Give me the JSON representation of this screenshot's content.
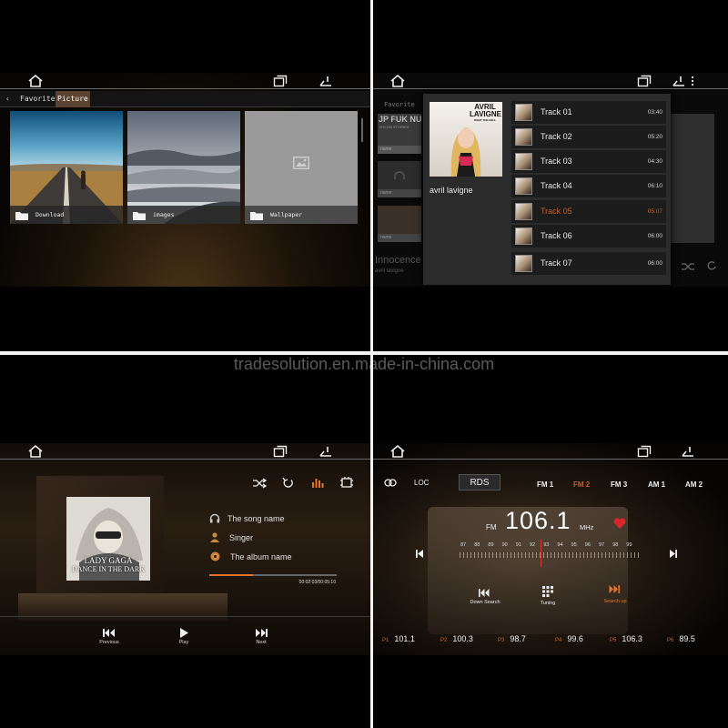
{
  "watermark": "tradesolution.en.made-in-china.com",
  "colors": {
    "accent": "#c0602a",
    "divider": "#f2f2f2",
    "tile_empty": "#9a9a9a",
    "heart": "#d8262b"
  },
  "gallery": {
    "breadcrumb": {
      "back_icon": "chevron-left-icon",
      "favorite": "Favorite",
      "picture": "Picture"
    },
    "folders": [
      {
        "label": "Download",
        "icon": "folder-icon"
      },
      {
        "label": "images",
        "icon": "folder-icon"
      },
      {
        "label": "Wallpaper",
        "icon": "folder-icon"
      }
    ]
  },
  "music": {
    "bg_tab": "Favorite",
    "bg_tiles": [
      "name",
      "name",
      "name"
    ],
    "bg_song": "Innocence",
    "bg_artist": "avril lavigne",
    "album_cover_text": [
      "AVRIL",
      "LAVIGNE",
      "WHAT THE HELL"
    ],
    "bg_album_text": [
      "JP FUK NUT",
      "NYLON STORIES"
    ],
    "artist": "avril lavigne",
    "tracks": [
      {
        "name": "Track 01",
        "duration": "03:40",
        "active": false
      },
      {
        "name": "Track 02",
        "duration": "05:20",
        "active": false
      },
      {
        "name": "Track 03",
        "duration": "04:30",
        "active": false
      },
      {
        "name": "Track 04",
        "duration": "06:10",
        "active": false
      },
      {
        "name": "Track 05",
        "duration": "05:07",
        "active": true
      },
      {
        "name": "Track 06",
        "duration": "06:00",
        "active": false
      },
      {
        "name": "Track 07",
        "duration": "06:00",
        "active": false
      }
    ]
  },
  "player": {
    "album_text_line1": "LADY GAGA",
    "album_text_line2": "DANCE IN THE DARK",
    "song_name": "The song name",
    "singer": "Singer",
    "album_name": "The album name",
    "time": "00:02:03/00:05:10",
    "progress": 0.34,
    "controls": {
      "previous": "Previous",
      "play": "Play",
      "next": "Next"
    }
  },
  "radio": {
    "loc": "LOC",
    "rds": "RDS",
    "bands": [
      {
        "label": "FM 1",
        "active": false
      },
      {
        "label": "FM 2",
        "active": true
      },
      {
        "label": "FM 3",
        "active": false
      },
      {
        "label": "AM 1",
        "active": false
      },
      {
        "label": "AM 2",
        "active": false
      }
    ],
    "band_label": "FM",
    "frequency": "106.1",
    "unit": "MHz",
    "scale": [
      "87",
      "88",
      "89",
      "90",
      "91",
      "92",
      "93",
      "94",
      "95",
      "96",
      "97",
      "98",
      "99"
    ],
    "needle_frequency": 92.5,
    "down_search": "Down Search",
    "tuning": "Tuning",
    "search_up": "Search up",
    "presets": [
      {
        "label": "P1",
        "value": "101.1"
      },
      {
        "label": "P2",
        "value": "100.3"
      },
      {
        "label": "P3",
        "value": "98.7"
      },
      {
        "label": "P4",
        "value": "99.6"
      },
      {
        "label": "P5",
        "value": "106.3"
      },
      {
        "label": "P6",
        "value": "89.5"
      }
    ]
  }
}
